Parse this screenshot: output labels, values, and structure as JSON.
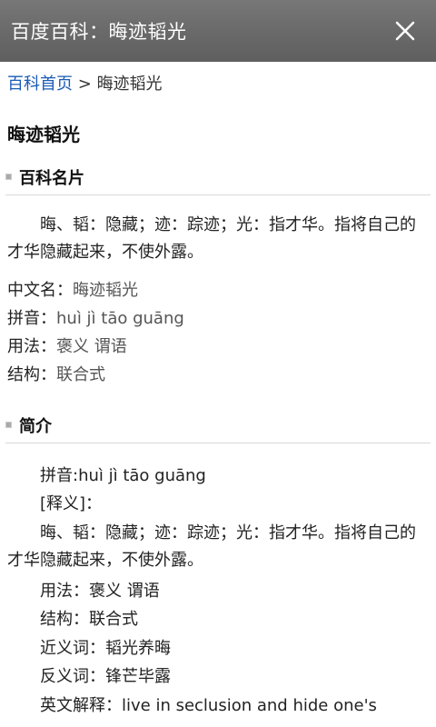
{
  "header": {
    "title": "百度百科：晦迹韬光"
  },
  "breadcrumb": {
    "home_link": "百科首页",
    "separator": ">",
    "current": "晦迹韬光"
  },
  "page_title": "晦迹韬光",
  "card": {
    "heading": "百科名片",
    "summary": "晦、韬：隐藏；迹：踪迹；光：指才华。指将自己的才华隐藏起来，不使外露。",
    "fields": [
      {
        "label": "中文名：",
        "value": "晦迹韬光"
      },
      {
        "label": "拼音：",
        "value": "huì jì tāo guāng"
      },
      {
        "label": "用法：",
        "value": "褒义 谓语"
      },
      {
        "label": "结构：",
        "value": "联合式"
      }
    ]
  },
  "intro": {
    "heading": "简介",
    "pinyin": "拼音:huì jì tāo guāng",
    "shiyi_label": "[释义]：",
    "shiyi_text": "晦、韬：隐藏；迹：踪迹；光：指才华。指将自己的才华隐藏起来，不使外露。",
    "usage": "用法：褒义 谓语",
    "structure": "结构：联合式",
    "synonym": "近义词：韬光养晦",
    "antonym": "反义词：锋芒毕露",
    "english": "英文解释：live in seclusion and hide one's"
  }
}
